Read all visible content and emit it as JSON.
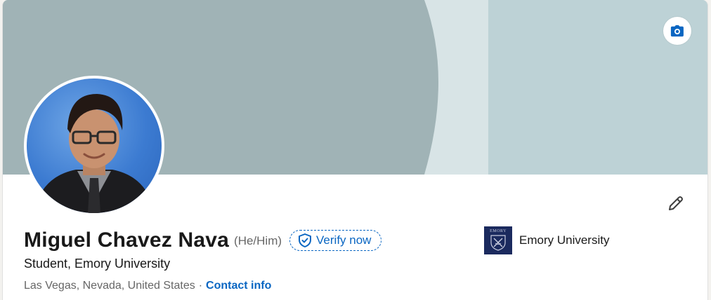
{
  "profile": {
    "name": "Miguel Chavez Nava",
    "pronouns": "(He/Him)",
    "verify_label": "Verify now",
    "headline": "Student, Emory University",
    "location": "Las Vegas, Nevada, United States",
    "separator": "·",
    "contact_label": "Contact info"
  },
  "education": {
    "logo_text": "EMORY",
    "name": "Emory University"
  },
  "icons": {
    "camera": "camera-icon",
    "edit": "pencil-icon",
    "verify": "shield-check-icon"
  },
  "colors": {
    "link": "#0a66c2",
    "banner_dark": "#a0b3b6",
    "banner_light": "#bdd2d6",
    "banner_gap": "#d8e4e6",
    "emory_blue": "#1b2a5e"
  }
}
